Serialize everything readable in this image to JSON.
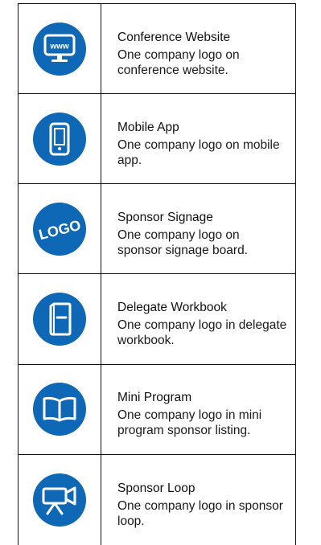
{
  "items": [
    {
      "icon": "website-icon",
      "title": "Conference Website",
      "description": "One company logo on conference website."
    },
    {
      "icon": "mobile-phone-icon",
      "title": "Mobile App",
      "description": "One company logo on mobile app."
    },
    {
      "icon": "logo-badge-icon",
      "title": "Sponsor Signage",
      "description": "One company logo on sponsor signage board.",
      "icon_text": "LOGO"
    },
    {
      "icon": "workbook-icon",
      "title": "Delegate Workbook",
      "description": "One company logo in delegate workbook."
    },
    {
      "icon": "open-book-icon",
      "title": "Mini Program",
      "description": "One company logo in mini program sponsor listing."
    },
    {
      "icon": "video-camera-icon",
      "title": "Sponsor Loop",
      "description": "One company logo in sponsor loop."
    }
  ],
  "colors": {
    "accent": "#0f68b5",
    "border": "#111111",
    "text": "#111111"
  },
  "website_icon_text": "www"
}
